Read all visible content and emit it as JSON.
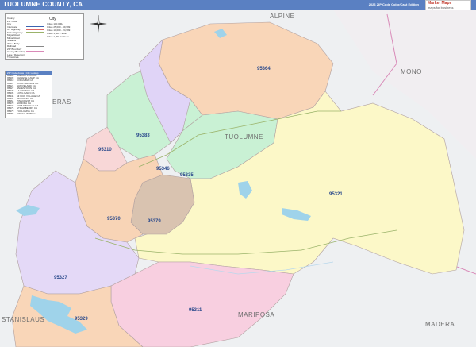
{
  "title": "TUOLUMNE COUNTY, CA",
  "subtitle": "2026 ZIP Code Color/Cast Edition",
  "logo": {
    "brand": "Market Maps",
    "tagline": "maps for business"
  },
  "legend": {
    "rows": [
      "County",
      "ZIP Code",
      "City",
      "Interstate",
      "US Highway",
      "State Highway",
      "Major Road",
      "Minor Road",
      "Streams",
      "Water Body",
      "Railroad",
      "ZIP Boundary",
      "County Boundary",
      "Lake / Reservoir",
      "Tribal Area"
    ],
    "city_label": "City",
    "right_rows": [
      "Cities 100,000+",
      "Cities 25,000 - 99,999",
      "Cities 10,000 - 24,999",
      "Cities 1,000 - 9,999",
      "Cities 1,000 and less"
    ]
  },
  "zip_index": {
    "header": "ZIP Code Areas / City Lookup",
    "rows": [
      [
        "95305",
        "BIG OAK FLAT",
        "CA"
      ],
      [
        "95309",
        "CHINESE CAMP",
        "CA"
      ],
      [
        "95310",
        "COLUMBIA",
        "CA"
      ],
      [
        "95311",
        "COULTERVILLE",
        "CA"
      ],
      [
        "95321",
        "GROVELAND",
        "CA"
      ],
      [
        "95327",
        "JAMESTOWN",
        "CA"
      ],
      [
        "95329",
        "LA GRANGE",
        "CA"
      ],
      [
        "95335",
        "LONG BARN",
        "CA"
      ],
      [
        "95346",
        "MI WUK VILLAGE",
        "CA"
      ],
      [
        "95347",
        "MOCCASIN",
        "CA"
      ],
      [
        "95364",
        "PINECREST",
        "CA"
      ],
      [
        "95370",
        "SONORA",
        "CA"
      ],
      [
        "95372",
        "SOULSBYVILLE",
        "CA"
      ],
      [
        "95375",
        "STRAWBERRY",
        "CA"
      ],
      [
        "95379",
        "TUOLUMNE",
        "CA"
      ],
      [
        "95383",
        "TWAIN HARTE",
        "CA"
      ]
    ]
  },
  "regions": {
    "alpine": "ALPINE",
    "mono": "MONO",
    "tuolumne": "TUOLUMNE",
    "mariposa": "MARIPOSA",
    "madera": "MADERA",
    "stanislaus": "STANISLAUS",
    "calaveras": "ERAS"
  },
  "zips": {
    "z95364": "95364",
    "z95383": "95383",
    "z95310": "95310",
    "z95346": "95346",
    "z95335": "95335",
    "z95321": "95321",
    "z95370": "95370",
    "z95379": "95379",
    "z95327": "95327",
    "z95311": "95311",
    "z95329": "95329"
  },
  "colors": {
    "title_bar": "#5a80c2",
    "zip_95364": "#f9d6b8",
    "zip_95383": "#c9f1d4",
    "zip_95335": "#c9f1d4",
    "zip_95321": "#fcf8c8",
    "zip_95379": "#d9c3b0",
    "zip_95370": "#f8d4b6",
    "zip_95327": "#e4d9f7",
    "zip_95311": "#f8cfe0",
    "zip_95310": "#f8d7d7",
    "zip_purple": "#e0d4f7",
    "water": "#9fd3ea",
    "county_line": "#d98ab8"
  }
}
